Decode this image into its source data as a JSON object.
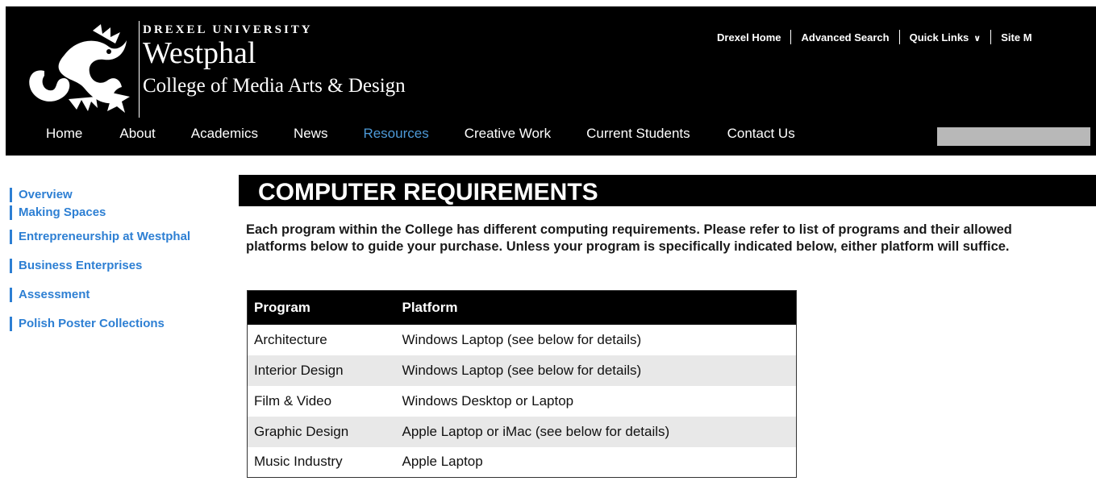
{
  "logo": {
    "university": "DREXEL UNIVERSITY",
    "name": "Westphal",
    "college": "College of Media Arts & Design"
  },
  "util_nav": {
    "items": [
      "Drexel Home",
      "Advanced Search",
      "Quick Links",
      "Site M"
    ]
  },
  "main_nav": {
    "items": [
      "Home",
      "About",
      "Academics",
      "News",
      "Resources",
      "Creative Work",
      "Current Students",
      "Contact Us"
    ],
    "active": "Resources"
  },
  "sidebar": {
    "items": [
      "Overview",
      "Making Spaces",
      "Entrepreneurship at Westphal",
      "Business Enterprises",
      "Assessment",
      "Polish Poster Collections"
    ]
  },
  "page": {
    "title": "COMPUTER REQUIREMENTS",
    "intro": "Each program within the College has different computing requirements. Please refer to list of programs and their allowed platforms below to guide your purchase. Unless your program is specifically indicated below, either platform will suffice."
  },
  "table": {
    "headers": [
      "Program",
      "Platform"
    ],
    "rows": [
      [
        "Architecture",
        "Windows Laptop (see below for details)"
      ],
      [
        "Interior Design",
        "Windows Laptop (see below for details)"
      ],
      [
        "Film & Video",
        "Windows Desktop or Laptop"
      ],
      [
        "Graphic Design",
        "Apple Laptop or iMac (see below for details)"
      ],
      [
        "Music Industry",
        "Apple Laptop"
      ]
    ]
  },
  "colors": {
    "link_blue": "#2d7fd3",
    "active_nav": "#4d9ad8",
    "header_bg": "#000000",
    "stripe": "#e8e8e8"
  },
  "icons": {
    "logo": "dragon-logo-icon",
    "quick_links": "chevron-down-icon"
  }
}
